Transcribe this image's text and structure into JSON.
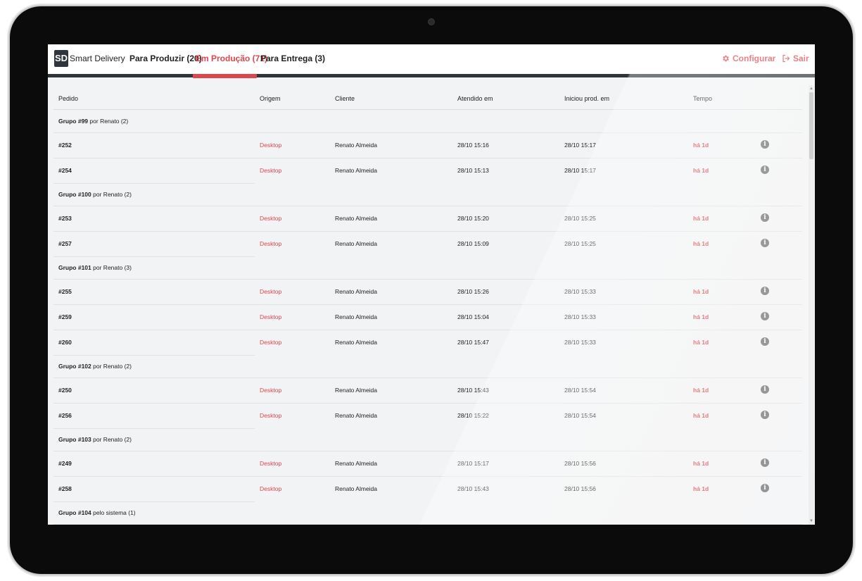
{
  "app": {
    "logo": "SD",
    "name": "Smart Delivery"
  },
  "tabs": [
    {
      "label": "Para Produzir (20)",
      "active": false
    },
    {
      "label": "Em Produção (71)",
      "active": true
    },
    {
      "label": "Para Entrega (3)",
      "active": false
    }
  ],
  "header_actions": {
    "configure_label": "Configurar",
    "configure_icon": "gear-icon",
    "exit_label": "Sair",
    "exit_icon": "exit-icon"
  },
  "colors": {
    "accent": "#e0454b",
    "dark": "#2f353c"
  },
  "columns": [
    "Pedido",
    "Origem",
    "Cliente",
    "Atendido em",
    "Iniciou prod. em",
    "Tempo"
  ],
  "groups": [
    {
      "id": "Grupo #99",
      "by": "por Renato (2)",
      "orders": [
        {
          "id": "#252",
          "origin": "Desktop",
          "client": "Renato Almeida",
          "attended": "28/10 15:16",
          "started": "28/10 15:17",
          "time": "há 1d"
        },
        {
          "id": "#254",
          "origin": "Desktop",
          "client": "Renato Almeida",
          "attended": "28/10 15:13",
          "started": "28/10 15:17",
          "time": "há 1d"
        }
      ]
    },
    {
      "id": "Grupo #100",
      "by": "por Renato (2)",
      "orders": [
        {
          "id": "#253",
          "origin": "Desktop",
          "client": "Renato Almeida",
          "attended": "28/10 15:20",
          "started": "28/10 15:25",
          "time": "há 1d"
        },
        {
          "id": "#257",
          "origin": "Desktop",
          "client": "Renato Almeida",
          "attended": "28/10 15:09",
          "started": "28/10 15:25",
          "time": "há 1d"
        }
      ]
    },
    {
      "id": "Grupo #101",
      "by": "por Renato (3)",
      "orders": [
        {
          "id": "#255",
          "origin": "Desktop",
          "client": "Renato Almeida",
          "attended": "28/10 15:26",
          "started": "28/10 15:33",
          "time": "há 1d"
        },
        {
          "id": "#259",
          "origin": "Desktop",
          "client": "Renato Almeida",
          "attended": "28/10 15:04",
          "started": "28/10 15:33",
          "time": "há 1d"
        },
        {
          "id": "#260",
          "origin": "Desktop",
          "client": "Renato Almeida",
          "attended": "28/10 15:47",
          "started": "28/10 15:33",
          "time": "há 1d"
        }
      ]
    },
    {
      "id": "Grupo #102",
      "by": "por Renato (2)",
      "orders": [
        {
          "id": "#250",
          "origin": "Desktop",
          "client": "Renato Almeida",
          "attended": "28/10 15:43",
          "started": "28/10 15:54",
          "time": "há 1d"
        },
        {
          "id": "#256",
          "origin": "Desktop",
          "client": "Renato Almeida",
          "attended": "28/10 15:22",
          "started": "28/10 15:54",
          "time": "há 1d"
        }
      ]
    },
    {
      "id": "Grupo #103",
      "by": "por Renato (2)",
      "orders": [
        {
          "id": "#249",
          "origin": "Desktop",
          "client": "Renato Almeida",
          "attended": "28/10 15:17",
          "started": "28/10 15:56",
          "time": "há 1d"
        },
        {
          "id": "#258",
          "origin": "Desktop",
          "client": "Renato Almeida",
          "attended": "28/10 15:43",
          "started": "28/10 15:56",
          "time": "há 1d"
        }
      ]
    },
    {
      "id": "Grupo #104",
      "by": "pelo sistema (1)",
      "orders": []
    }
  ]
}
